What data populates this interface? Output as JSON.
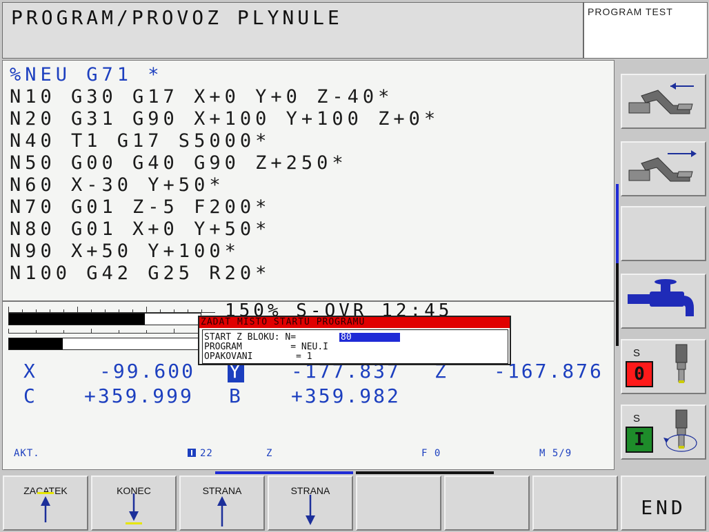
{
  "header": {
    "title": "PROGRAM/PROVOZ PLYNULE",
    "mode": "PROGRAM TEST"
  },
  "program": {
    "lines": [
      "%NEU G71 *",
      "N10 G30 G17 X+0 Y+0 Z-40*",
      "N20 G31 G90 X+100 Y+100 Z+0*",
      "N40 T1 G17 S5000*",
      "N50 G00 G40 G90 Z+250*",
      "N60 X-30 Y+50*",
      "N70 G01 Z-5 F200*",
      "N80 G01 X+0 Y+50*",
      "N90 X+50 Y+100*",
      "N100 G42 G25 R20*"
    ]
  },
  "status": {
    "override_text": "150% S-OVR 12:45",
    "feed_override_fraction": 0.28,
    "spindle_override_fraction": 0.71,
    "positions": {
      "row1": [
        {
          "axis": "X",
          "value": "-99.600"
        },
        {
          "axis": "Y",
          "value": "-177.837"
        },
        {
          "axis": "Z",
          "value": "-167.876"
        }
      ],
      "row2": [
        {
          "axis": "C",
          "value": "+359.999"
        },
        {
          "axis": "B",
          "value": "+359.982"
        }
      ]
    },
    "mode_label": "AKT.",
    "tool": "22",
    "tool_axis": "Z",
    "feed": "F 0",
    "m_functions": "M 5/9"
  },
  "dialog": {
    "title": "ZADAT MISTO STARTU PROGRAMU",
    "start_label": "START Z BLOKU: N=",
    "start_value": "80",
    "program_label": "PROGRAM         = NEU.I",
    "repeat_label": "OPAKOVANI        = 1"
  },
  "side": {
    "spindle1_label": "S",
    "spindle1_value": "0",
    "spindle2_label": "S",
    "spindle2_value": "I"
  },
  "softkeys": {
    "k1": "ZACATEK",
    "k2": "KONEC",
    "k3": "STRANA",
    "k4": "STRANA",
    "end": "END"
  },
  "colors": {
    "accent": "#1c3fbf",
    "dialog_title": "#e00000",
    "stop_red": "#ff1a1a",
    "start_green": "#1e8c2a"
  },
  "icons": [
    "machine-path-back-icon",
    "machine-path-forward-icon",
    "faucet-icon",
    "spindle-icon",
    "spindle-rotate-icon",
    "arrow-up-icon",
    "arrow-down-icon"
  ]
}
